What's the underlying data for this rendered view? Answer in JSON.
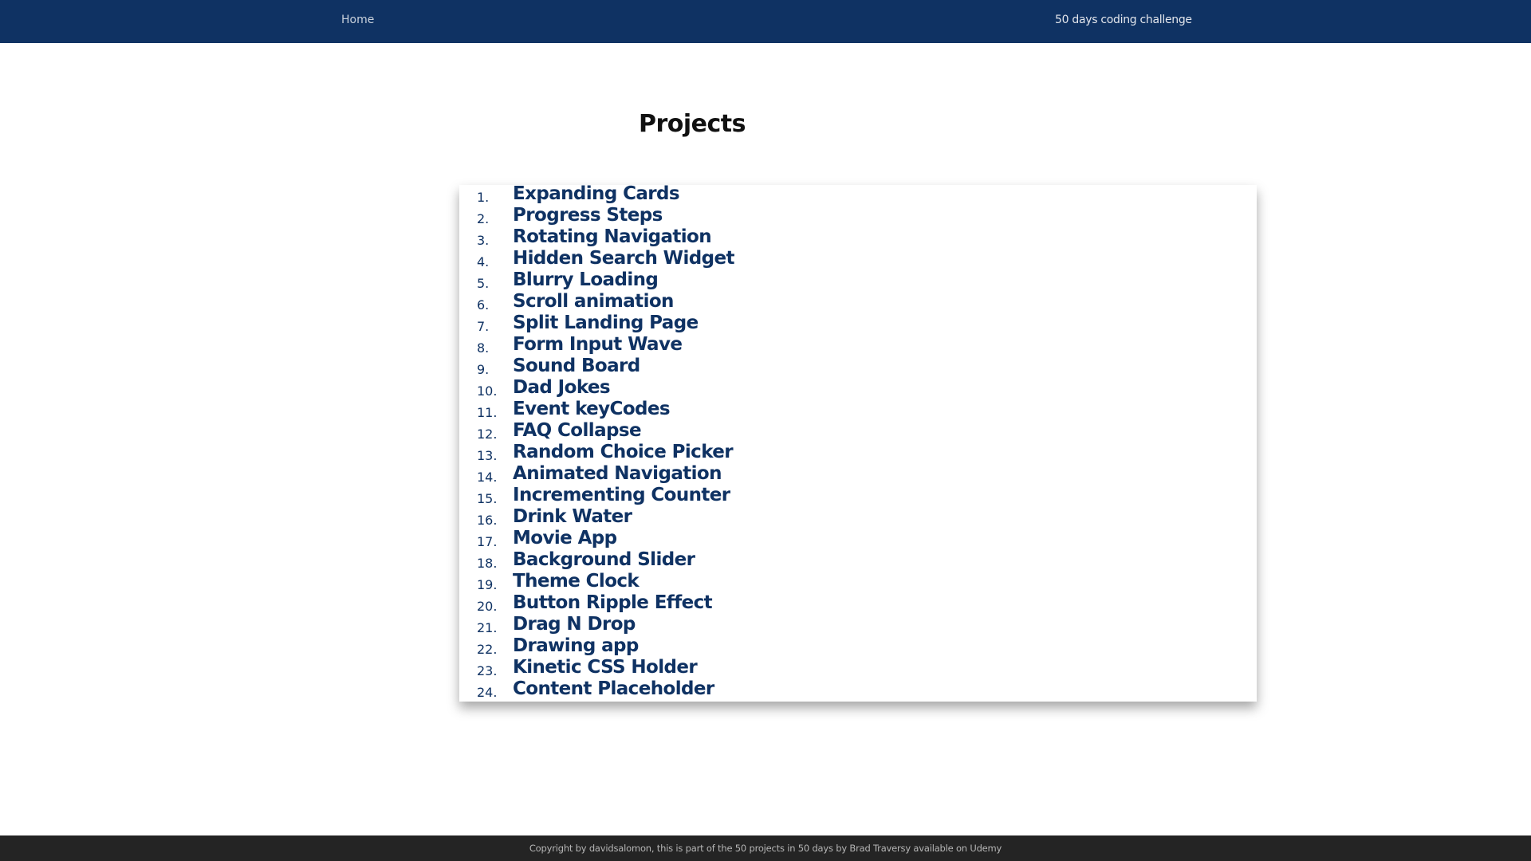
{
  "navbar": {
    "home_label": "Home",
    "title": "50 days coding challenge",
    "background_color": "#0f3263"
  },
  "main": {
    "title": "Projects",
    "projects": [
      {
        "number": "1.",
        "label": "Expanding Cards"
      },
      {
        "number": "2.",
        "label": "Progress Steps"
      },
      {
        "number": "3.",
        "label": "Rotating Navigation"
      },
      {
        "number": "4.",
        "label": "Hidden Search Widget"
      },
      {
        "number": "5.",
        "label": "Blurry Loading"
      },
      {
        "number": "6.",
        "label": "Scroll animation"
      },
      {
        "number": "7.",
        "label": "Split Landing Page"
      },
      {
        "number": "8.",
        "label": "Form Input Wave"
      },
      {
        "number": "9.",
        "label": "Sound Board"
      },
      {
        "number": "10.",
        "label": "Dad Jokes"
      },
      {
        "number": "11.",
        "label": "Event keyCodes"
      },
      {
        "number": "12.",
        "label": "FAQ Collapse"
      },
      {
        "number": "13.",
        "label": "Random Choice Picker"
      },
      {
        "number": "14.",
        "label": "Animated Navigation"
      },
      {
        "number": "15.",
        "label": "Incrementing Counter"
      },
      {
        "number": "16.",
        "label": "Drink Water"
      },
      {
        "number": "17.",
        "label": "Movie App"
      },
      {
        "number": "18.",
        "label": "Background Slider"
      },
      {
        "number": "19.",
        "label": "Theme Clock"
      },
      {
        "number": "20.",
        "label": "Button Ripple Effect"
      },
      {
        "number": "21.",
        "label": "Drag N Drop"
      },
      {
        "number": "22.",
        "label": "Drawing app"
      },
      {
        "number": "23.",
        "label": "Kinetic CSS Holder"
      },
      {
        "number": "24.",
        "label": "Content Placeholder"
      }
    ]
  },
  "footer": {
    "text": "Copyright by davidsalomon, this is part of the 50 projects in 50 days by Brad Traversy available on Udemy"
  }
}
